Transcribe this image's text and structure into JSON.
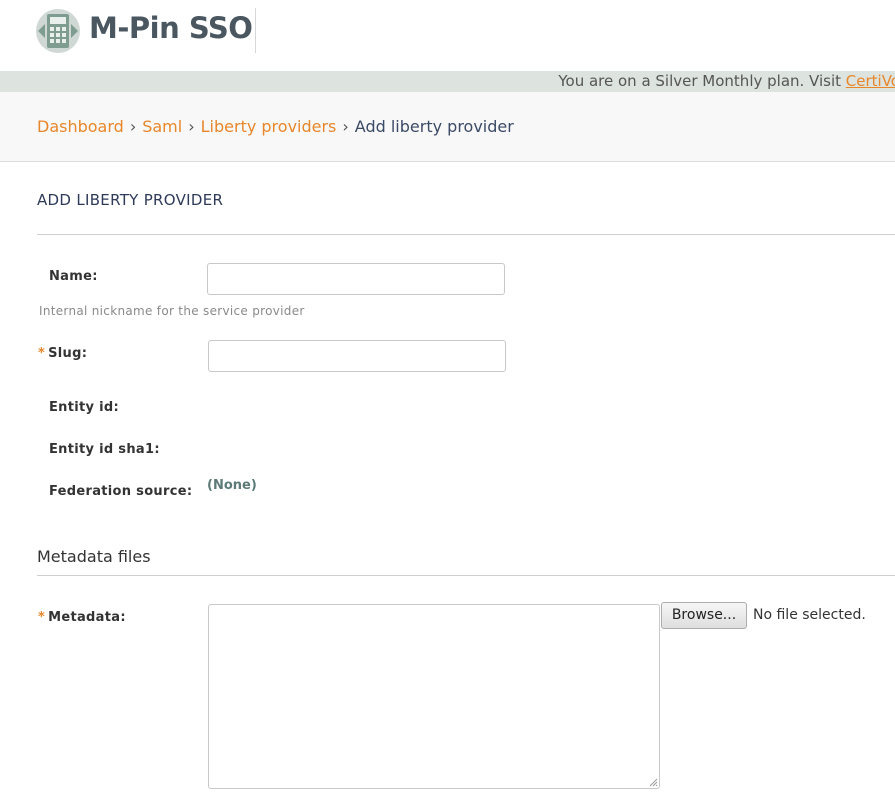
{
  "brand": {
    "name": "M-Pin SSO",
    "icon": "calculator-logo-icon"
  },
  "plan_banner": {
    "text": "You are on a Silver Monthly plan. Visit ",
    "link": "CertiVo"
  },
  "breadcrumb": {
    "items": [
      "Dashboard",
      "Saml",
      "Liberty providers"
    ],
    "separator": "›",
    "current": "Add liberty provider"
  },
  "page": {
    "title": "ADD LIBERTY PROVIDER"
  },
  "form": {
    "name": {
      "label": "Name:",
      "value": "",
      "help": "Internal nickname for the service provider"
    },
    "slug": {
      "label": "Slug:",
      "value": "",
      "required": "*"
    },
    "entity_id": {
      "label": "Entity id:"
    },
    "entity_id_sha1": {
      "label": "Entity id sha1:"
    },
    "federation_source": {
      "label": "Federation source:",
      "value": "(None)"
    }
  },
  "metadata_section": {
    "title": "Metadata files",
    "metadata": {
      "label": "Metadata:",
      "required": "*",
      "value": ""
    },
    "browse_label": "Browse...",
    "file_status": "No file selected."
  },
  "colors": {
    "accent": "#e8862a",
    "title": "#2e3a58",
    "plan_bar": "#dde3de"
  }
}
